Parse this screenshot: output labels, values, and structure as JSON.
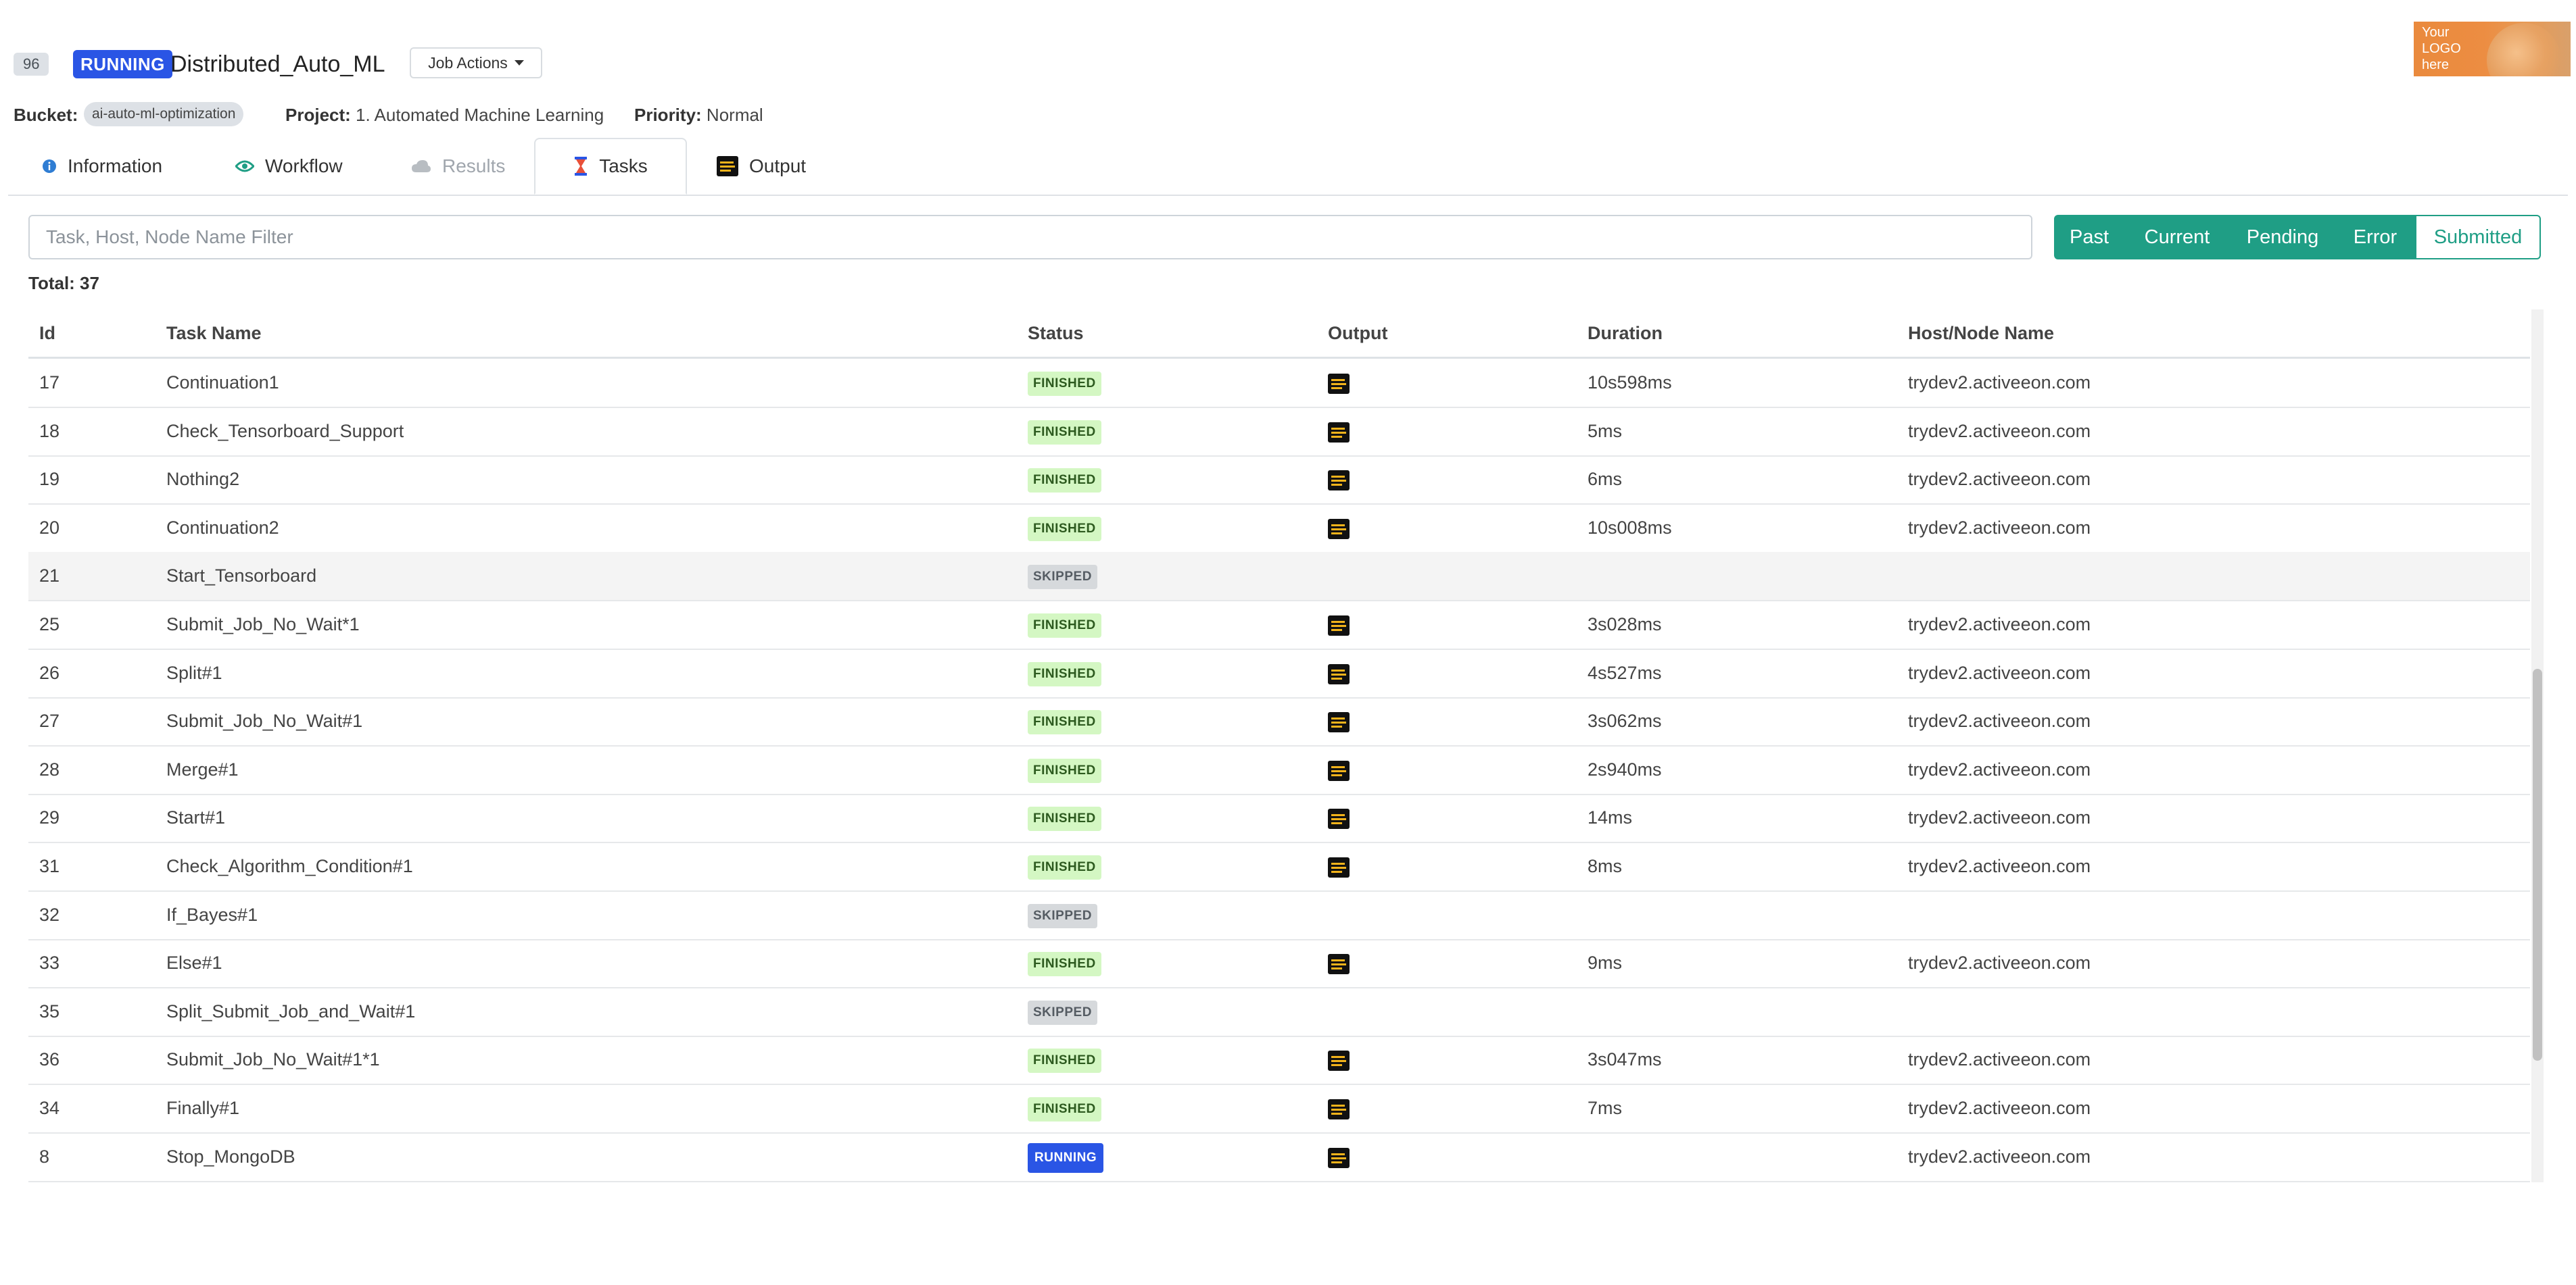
{
  "job": {
    "id": "96",
    "status": "RUNNING",
    "name": "Distributed_Auto_ML",
    "actions_label": "Job Actions",
    "logo_text": "Your LOGO here"
  },
  "meta": {
    "bucket_label": "Bucket:",
    "bucket_value": "ai-auto-ml-optimization",
    "project_label": "Project:",
    "project_value": "1. Automated Machine Learning",
    "priority_label": "Priority:",
    "priority_value": "Normal"
  },
  "tabs": [
    {
      "label": "Information",
      "icon": "info-icon"
    },
    {
      "label": "Workflow",
      "icon": "eye-icon"
    },
    {
      "label": "Results",
      "icon": "cloud-icon",
      "disabled": true
    },
    {
      "label": "Tasks",
      "icon": "hourglass-icon",
      "active": true
    },
    {
      "label": "Output",
      "icon": "output-icon"
    }
  ],
  "filter": {
    "placeholder": "Task, Host, Node Name Filter",
    "value": ""
  },
  "status_filters": [
    "Past",
    "Current",
    "Pending",
    "Error",
    "Submitted"
  ],
  "total_label": "Total: 37",
  "columns": [
    "Id",
    "Task Name",
    "Status",
    "Output",
    "Duration",
    "Host/Node Name"
  ],
  "rows": [
    {
      "id": "17",
      "name": "Continuation1",
      "status": "FINISHED",
      "output": true,
      "duration": "10s598ms",
      "host": "trydev2.activeeon.com"
    },
    {
      "id": "18",
      "name": "Check_Tensorboard_Support",
      "status": "FINISHED",
      "output": true,
      "duration": "5ms",
      "host": "trydev2.activeeon.com"
    },
    {
      "id": "19",
      "name": "Nothing2",
      "status": "FINISHED",
      "output": true,
      "duration": "6ms",
      "host": "trydev2.activeeon.com"
    },
    {
      "id": "20",
      "name": "Continuation2",
      "status": "FINISHED",
      "output": true,
      "duration": "10s008ms",
      "host": "trydev2.activeeon.com"
    },
    {
      "id": "21",
      "name": "Start_Tensorboard",
      "status": "SKIPPED",
      "output": false,
      "duration": "",
      "host": ""
    },
    {
      "id": "25",
      "name": "Submit_Job_No_Wait*1",
      "status": "FINISHED",
      "output": true,
      "duration": "3s028ms",
      "host": "trydev2.activeeon.com"
    },
    {
      "id": "26",
      "name": "Split#1",
      "status": "FINISHED",
      "output": true,
      "duration": "4s527ms",
      "host": "trydev2.activeeon.com"
    },
    {
      "id": "27",
      "name": "Submit_Job_No_Wait#1",
      "status": "FINISHED",
      "output": true,
      "duration": "3s062ms",
      "host": "trydev2.activeeon.com"
    },
    {
      "id": "28",
      "name": "Merge#1",
      "status": "FINISHED",
      "output": true,
      "duration": "2s940ms",
      "host": "trydev2.activeeon.com"
    },
    {
      "id": "29",
      "name": "Start#1",
      "status": "FINISHED",
      "output": true,
      "duration": "14ms",
      "host": "trydev2.activeeon.com"
    },
    {
      "id": "31",
      "name": "Check_Algorithm_Condition#1",
      "status": "FINISHED",
      "output": true,
      "duration": "8ms",
      "host": "trydev2.activeeon.com"
    },
    {
      "id": "32",
      "name": "If_Bayes#1",
      "status": "SKIPPED",
      "output": false,
      "duration": "",
      "host": ""
    },
    {
      "id": "33",
      "name": "Else#1",
      "status": "FINISHED",
      "output": true,
      "duration": "9ms",
      "host": "trydev2.activeeon.com"
    },
    {
      "id": "35",
      "name": "Split_Submit_Job_and_Wait#1",
      "status": "SKIPPED",
      "output": false,
      "duration": "",
      "host": ""
    },
    {
      "id": "36",
      "name": "Submit_Job_No_Wait#1*1",
      "status": "FINISHED",
      "output": true,
      "duration": "3s047ms",
      "host": "trydev2.activeeon.com"
    },
    {
      "id": "34",
      "name": "Finally#1",
      "status": "FINISHED",
      "output": true,
      "duration": "7ms",
      "host": "trydev2.activeeon.com"
    },
    {
      "id": "8",
      "name": "Stop_MongoDB",
      "status": "RUNNING",
      "output": true,
      "duration": "",
      "host": "trydev2.activeeon.com"
    }
  ],
  "colors": {
    "accent_teal": "#1f9e85",
    "running_blue": "#2a55e5",
    "finished_green_bg": "#d4f7c3",
    "skipped_gray_bg": "#d6d9dc"
  }
}
